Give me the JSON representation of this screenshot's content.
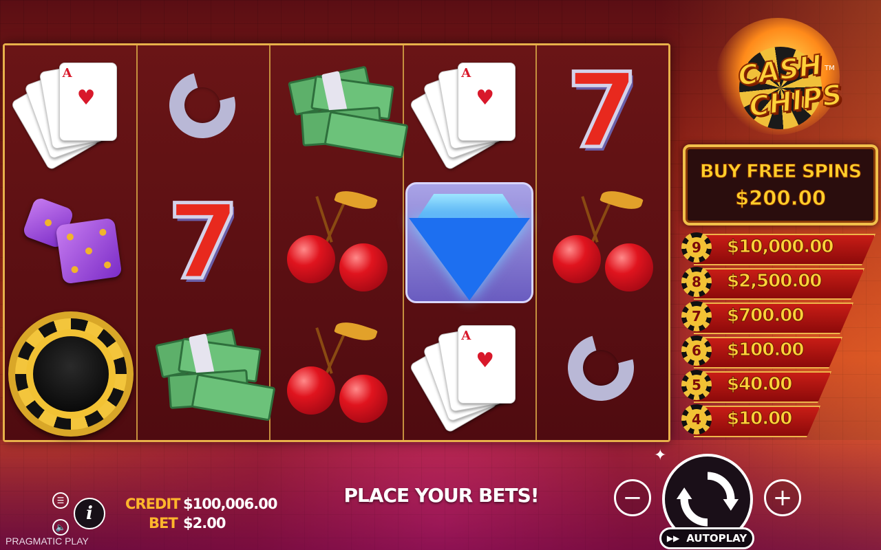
{
  "game": {
    "logo_line1": "CASH",
    "logo_line2": "CHIPS",
    "logo_tm": "TM"
  },
  "buy_free_spins": {
    "label": "BUY FREE SPINS",
    "price": "$200.00"
  },
  "paytable": [
    {
      "count": "9",
      "amount": "$10,000.00"
    },
    {
      "count": "8",
      "amount": "$2,500.00"
    },
    {
      "count": "7",
      "amount": "$700.00"
    },
    {
      "count": "6",
      "amount": "$100.00"
    },
    {
      "count": "5",
      "amount": "$40.00"
    },
    {
      "count": "4",
      "amount": "$10.00"
    }
  ],
  "reels": [
    [
      "cards-icon",
      "dice-icon",
      "chip-icon"
    ],
    [
      "horseshoe-icon",
      "seven-icon",
      "money-icon"
    ],
    [
      "money-icon",
      "cherry-icon",
      "cherry-icon"
    ],
    [
      "cards-icon",
      "diamond-icon",
      "cards-icon"
    ],
    [
      "seven-icon",
      "cherry-icon",
      "horseshoe-icon"
    ]
  ],
  "bottom": {
    "credit_label": "CREDIT",
    "credit_value": "$100,006.00",
    "bet_label": "BET",
    "bet_value": "$2.00",
    "status": "PLACE YOUR BETS!",
    "autoplay_label": "AUTOPLAY",
    "brand": "PRAGMATIC PLAY",
    "info_glyph": "i",
    "minus_glyph": "−",
    "plus_glyph": "+"
  },
  "colors": {
    "accent_gold": "#f1c04a",
    "amount_yellow": "#ffd23a",
    "credit_orange": "#ffb62c"
  }
}
